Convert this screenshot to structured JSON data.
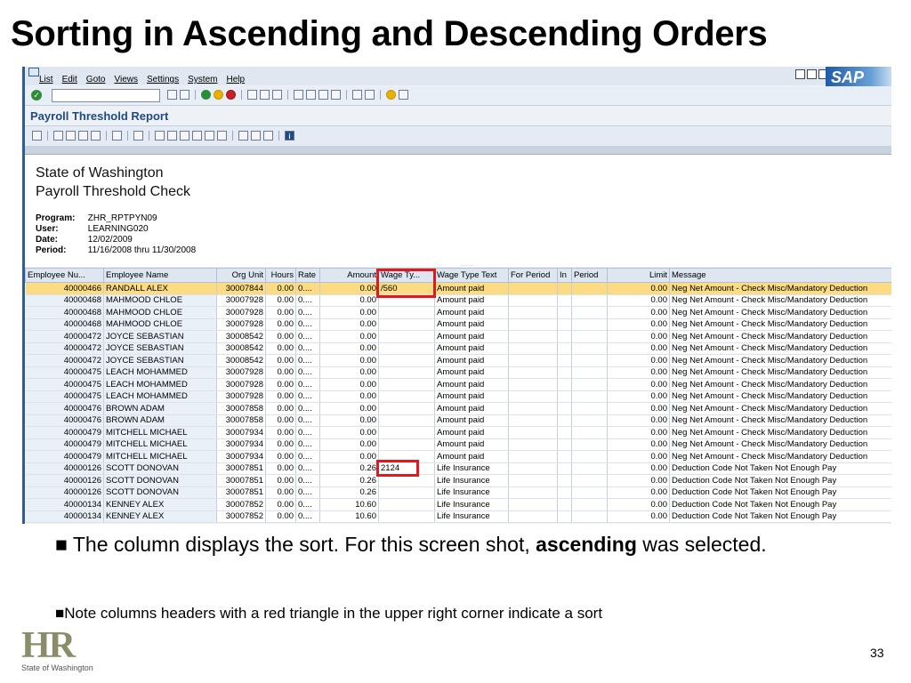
{
  "slide": {
    "title": "Sorting in Ascending and Descending Orders",
    "bullet1_pre": "■ The column displays the sort.  For this screen shot, ",
    "bullet1_bold": "ascending",
    "bullet1_post": " was selected.",
    "bullet2": "■Note columns headers with a red triangle in the upper right corner  indicate a sort",
    "page_number": "33",
    "logo_text": "HR",
    "logo_subtitle": "State of Washington"
  },
  "sap": {
    "menu": [
      "List",
      "Edit",
      "Goto",
      "Views",
      "Settings",
      "System",
      "Help"
    ],
    "brand": "SAP",
    "report_title": "Payroll Threshold Report",
    "header": {
      "line1": "State of Washington",
      "line2": "Payroll Threshold Check",
      "program_label": "Program:",
      "program_value": "ZHR_RPTPYN09",
      "user_label": "User:",
      "user_value": "LEARNING020",
      "date_label": "Date:",
      "date_value": "12/02/2009",
      "period_label": "Period:",
      "period_value": "11/16/2008 thru 11/30/2008",
      "dots": "....."
    },
    "columns": [
      "Employee Nu...",
      "Employee Name",
      "Org Unit",
      "Hours",
      "Rate",
      "Amount",
      "Wage Ty...",
      "Wage Type Text",
      "For Period",
      "In",
      "Period",
      "Limit",
      "Message"
    ],
    "rows": [
      [
        "40000466",
        "RANDALL ALEX",
        "30007844",
        "0.00",
        "0....",
        "0.00",
        "/560",
        "Amount paid",
        "",
        "",
        "",
        "0.00",
        "Neg Net Amount - Check Misc/Mandatory Deduction"
      ],
      [
        "40000468",
        "MAHMOOD CHLOE",
        "30007928",
        "0.00",
        "0....",
        "0.00",
        "",
        "Amount paid",
        "",
        "",
        "",
        "0.00",
        "Neg Net Amount - Check Misc/Mandatory Deduction"
      ],
      [
        "40000468",
        "MAHMOOD CHLOE",
        "30007928",
        "0.00",
        "0....",
        "0.00",
        "",
        "Amount paid",
        "",
        "",
        "",
        "0.00",
        "Neg Net Amount - Check Misc/Mandatory Deduction"
      ],
      [
        "40000468",
        "MAHMOOD CHLOE",
        "30007928",
        "0.00",
        "0....",
        "0.00",
        "",
        "Amount paid",
        "",
        "",
        "",
        "0.00",
        "Neg Net Amount - Check Misc/Mandatory Deduction"
      ],
      [
        "40000472",
        "JOYCE SEBASTIAN",
        "30008542",
        "0.00",
        "0....",
        "0.00",
        "",
        "Amount paid",
        "",
        "",
        "",
        "0.00",
        "Neg Net Amount - Check Misc/Mandatory Deduction"
      ],
      [
        "40000472",
        "JOYCE SEBASTIAN",
        "30008542",
        "0.00",
        "0....",
        "0.00",
        "",
        "Amount paid",
        "",
        "",
        "",
        "0.00",
        "Neg Net Amount - Check Misc/Mandatory Deduction"
      ],
      [
        "40000472",
        "JOYCE SEBASTIAN",
        "30008542",
        "0.00",
        "0....",
        "0.00",
        "",
        "Amount paid",
        "",
        "",
        "",
        "0.00",
        "Neg Net Amount - Check Misc/Mandatory Deduction"
      ],
      [
        "40000475",
        "LEACH MOHAMMED",
        "30007928",
        "0.00",
        "0....",
        "0.00",
        "",
        "Amount paid",
        "",
        "",
        "",
        "0.00",
        "Neg Net Amount - Check Misc/Mandatory Deduction"
      ],
      [
        "40000475",
        "LEACH MOHAMMED",
        "30007928",
        "0.00",
        "0....",
        "0.00",
        "",
        "Amount paid",
        "",
        "",
        "",
        "0.00",
        "Neg Net Amount - Check Misc/Mandatory Deduction"
      ],
      [
        "40000475",
        "LEACH MOHAMMED",
        "30007928",
        "0.00",
        "0....",
        "0.00",
        "",
        "Amount paid",
        "",
        "",
        "",
        "0.00",
        "Neg Net Amount - Check Misc/Mandatory Deduction"
      ],
      [
        "40000476",
        "BROWN ADAM",
        "30007858",
        "0.00",
        "0....",
        "0.00",
        "",
        "Amount paid",
        "",
        "",
        "",
        "0.00",
        "Neg Net Amount - Check Misc/Mandatory Deduction"
      ],
      [
        "40000476",
        "BROWN ADAM",
        "30007858",
        "0.00",
        "0....",
        "0.00",
        "",
        "Amount paid",
        "",
        "",
        "",
        "0.00",
        "Neg Net Amount - Check Misc/Mandatory Deduction"
      ],
      [
        "40000479",
        "MITCHELL MICHAEL",
        "30007934",
        "0.00",
        "0....",
        "0.00",
        "",
        "Amount paid",
        "",
        "",
        "",
        "0.00",
        "Neg Net Amount - Check Misc/Mandatory Deduction"
      ],
      [
        "40000479",
        "MITCHELL MICHAEL",
        "30007934",
        "0.00",
        "0....",
        "0.00",
        "",
        "Amount paid",
        "",
        "",
        "",
        "0.00",
        "Neg Net Amount - Check Misc/Mandatory Deduction"
      ],
      [
        "40000479",
        "MITCHELL MICHAEL",
        "30007934",
        "0.00",
        "0....",
        "0.00",
        "",
        "Amount paid",
        "",
        "",
        "",
        "0.00",
        "Neg Net Amount - Check Misc/Mandatory Deduction"
      ],
      [
        "40000126",
        "SCOTT DONOVAN",
        "30007851",
        "0.00",
        "0....",
        "0.26",
        "2124",
        "Life Insurance",
        "",
        "",
        "",
        "0.00",
        "Deduction Code Not Taken Not Enough Pay"
      ],
      [
        "40000126",
        "SCOTT DONOVAN",
        "30007851",
        "0.00",
        "0....",
        "0.26",
        "",
        "Life Insurance",
        "",
        "",
        "",
        "0.00",
        "Deduction Code Not Taken Not Enough Pay"
      ],
      [
        "40000126",
        "SCOTT DONOVAN",
        "30007851",
        "0.00",
        "0....",
        "0.26",
        "",
        "Life Insurance",
        "",
        "",
        "",
        "0.00",
        "Deduction Code Not Taken Not Enough Pay"
      ],
      [
        "40000134",
        "KENNEY ALEX",
        "30007852",
        "0.00",
        "0....",
        "10.60",
        "",
        "Life Insurance",
        "",
        "",
        "",
        "0.00",
        "Deduction Code Not Taken Not Enough Pay"
      ],
      [
        "40000134",
        "KENNEY ALEX",
        "30007852",
        "0.00",
        "0....",
        "10.60",
        "",
        "Life Insurance",
        "",
        "",
        "",
        "0.00",
        "Deduction Code Not Taken Not Enough Pay"
      ]
    ],
    "colors": {
      "selected_row": "#fbdc82",
      "highlight": "#e0191f",
      "title_blue": "#1f4a82"
    }
  }
}
